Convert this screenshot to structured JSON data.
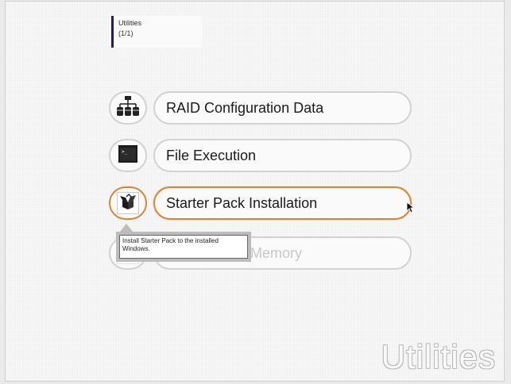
{
  "header": {
    "section_title": "Utilities",
    "page_count": "(1/1)"
  },
  "menu": {
    "items": [
      {
        "label": "RAID Configuration Data",
        "icon": "raid-config-icon",
        "state": "normal"
      },
      {
        "label": "File Execution",
        "icon": "terminal-icon",
        "state": "normal"
      },
      {
        "label": "Starter Pack Installation",
        "icon": "starter-pack-box-icon",
        "state": "active"
      },
      {
        "label": "Memory",
        "icon": "memory-icon",
        "state": "dimmed"
      }
    ]
  },
  "tooltip": {
    "text": "Install Starter Pack to the installed Windows."
  },
  "watermark": "Utilities",
  "colors": {
    "accent": "#d8843a",
    "indicator_bar": "#1f1f6e",
    "button_border": "#d2d2d2"
  }
}
